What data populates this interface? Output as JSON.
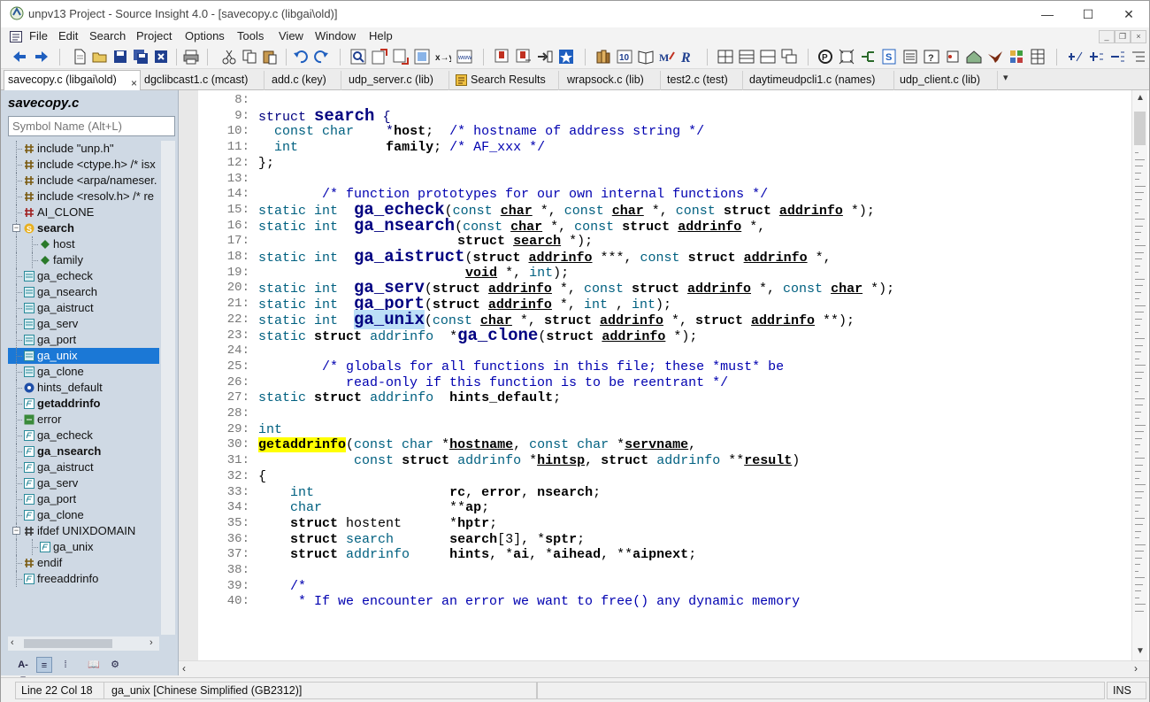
{
  "window": {
    "title": "unpv13 Project - Source Insight 4.0 - [savecopy.c (libgai\\old)]",
    "controls": {
      "minimize": "—",
      "maximize": "☐",
      "close": "✕"
    }
  },
  "menu": {
    "items": [
      "File",
      "Edit",
      "Search",
      "Project",
      "Options",
      "Tools",
      "View",
      "Window",
      "Help"
    ],
    "mdi": {
      "min": "_",
      "restore": "❐",
      "close": "×"
    }
  },
  "tabs": [
    {
      "label": "savecopy.c (libgai\\old)",
      "active": true
    },
    {
      "label": "dgclibcast1.c (mcast)"
    },
    {
      "label": "add.c (key)"
    },
    {
      "label": "udp_server.c (lib)"
    },
    {
      "label": "Search Results"
    },
    {
      "label": "wrapsock.c (lib)"
    },
    {
      "label": "test2.c (test)"
    },
    {
      "label": "daytimeudpcli1.c (names)"
    },
    {
      "label": "udp_client.c (lib)"
    }
  ],
  "tab_close": "×",
  "tab_more": "▾",
  "sidebar": {
    "file_name": "savecopy.c",
    "symbol_placeholder": "Symbol Name (Alt+L)",
    "tree": [
      {
        "label": "include \"unp.h\"",
        "icon": "include-icon"
      },
      {
        "label": "include <ctype.h> /* isx",
        "icon": "include-icon"
      },
      {
        "label": "include <arpa/nameser.",
        "icon": "include-icon"
      },
      {
        "label": "include <resolv.h> /* re",
        "icon": "include-icon"
      },
      {
        "label": "AI_CLONE",
        "icon": "define-icon"
      },
      {
        "label": "search",
        "icon": "struct-icon",
        "bold": true
      },
      {
        "label": "host",
        "icon": "member-icon"
      },
      {
        "label": "family",
        "icon": "member-icon"
      },
      {
        "label": "ga_echeck",
        "icon": "prototype-icon"
      },
      {
        "label": "ga_nsearch",
        "icon": "prototype-icon"
      },
      {
        "label": "ga_aistruct",
        "icon": "prototype-icon"
      },
      {
        "label": "ga_serv",
        "icon": "prototype-icon"
      },
      {
        "label": "ga_port",
        "icon": "prototype-icon"
      },
      {
        "label": "ga_unix",
        "icon": "prototype-icon",
        "selected": true
      },
      {
        "label": "ga_clone",
        "icon": "prototype-icon"
      },
      {
        "label": "hints_default",
        "icon": "variable-icon"
      },
      {
        "label": "getaddrinfo",
        "icon": "function-icon",
        "bold": true
      },
      {
        "label": "error",
        "icon": "label-icon"
      },
      {
        "label": "ga_echeck",
        "icon": "function-icon"
      },
      {
        "label": "ga_nsearch",
        "icon": "function-icon",
        "bold": true
      },
      {
        "label": "ga_aistruct",
        "icon": "function-icon"
      },
      {
        "label": "ga_serv",
        "icon": "function-icon"
      },
      {
        "label": "ga_port",
        "icon": "function-icon"
      },
      {
        "label": "ga_clone",
        "icon": "function-icon"
      },
      {
        "label": "ifdef UNIXDOMAIN",
        "icon": "ifdef-icon"
      },
      {
        "label": "ga_unix",
        "icon": "function-icon"
      },
      {
        "label": "endif",
        "icon": "include-icon"
      },
      {
        "label": "freeaddrinfo",
        "icon": "function-icon"
      }
    ],
    "bottom_buttons": [
      "A-Z",
      "≡",
      "⁞",
      "📖",
      "⚙"
    ]
  },
  "code": {
    "lines": [
      {
        "n": "8:",
        "html": ""
      },
      {
        "n": "9:",
        "html": "<span class='kw'>struct</span> <span class='big'>search</span> <span class='kw'>{</span>"
      },
      {
        "n": "10:",
        "html": "  <span class='ty'>const char</span>    <span class='kw'>*</span><b>host</b>;  <span class='cm'>/* hostname of address string */</span>"
      },
      {
        "n": "11:",
        "html": "  <span class='ty'>int</span>           <b>family</b>; <span class='cm'>/* AF_xxx */</span>"
      },
      {
        "n": "12:",
        "html": "};"
      },
      {
        "n": "13:",
        "html": ""
      },
      {
        "n": "14:",
        "html": "        <span class='cm'>/* function prototypes for our own internal functions */</span>"
      },
      {
        "n": "15:",
        "html": "<span class='ty'>static int</span>  <span class='big'>ga_echeck</span>(<span class='ty'>const</span> <span class='ul'>char</span> *, <span class='ty'>const</span> <span class='ul'>char</span> *, <span class='ty'>const</span> <b>struct</b> <span class='ul'>addrinfo</span> *);"
      },
      {
        "n": "16:",
        "html": "<span class='ty'>static int</span>  <span class='big'>ga_nsearch</span>(<span class='ty'>const</span> <span class='ul'>char</span> *, <span class='ty'>const</span> <b>struct</b> <span class='ul'>addrinfo</span> *,"
      },
      {
        "n": "17:",
        "html": "                         <b>struct</b> <span class='ul'>search</span> *);"
      },
      {
        "n": "18:",
        "html": "<span class='ty'>static int</span>  <span class='big'>ga_aistruct</span>(<b>struct</b> <span class='ul'>addrinfo</span> ***, <span class='ty'>const</span> <b>struct</b> <span class='ul'>addrinfo</span> *,"
      },
      {
        "n": "19:",
        "html": "                          <span class='ul'>void</span> *, <span class='ty'>int</span>);"
      },
      {
        "n": "20:",
        "html": "<span class='ty'>static int</span>  <span class='big'>ga_serv</span>(<b>struct</b> <span class='ul'>addrinfo</span> *, <span class='ty'>const</span> <b>struct</b> <span class='ul'>addrinfo</span> *, <span class='ty'>const</span> <span class='ul'>char</span> *);"
      },
      {
        "n": "21:",
        "html": "<span class='ty'>static int</span>  <span class='big'>ga_port</span>(<b>struct</b> <span class='ul'>addrinfo</span> *, <span class='ty'>int</span> , <span class='ty'>int</span>);"
      },
      {
        "n": "22:",
        "html": "<span class='ty'>static int</span>  <span class='big hlb'>ga_unix</span>(<span class='ty'>const</span> <span class='ul'>char</span> *, <b>struct</b> <span class='ul'>addrinfo</span> *, <b>struct</b> <span class='ul'>addrinfo</span> **);"
      },
      {
        "n": "23:",
        "html": "<span class='ty'>static</span> <b>struct</b> <span class='ty'>addrinfo</span>  *<span class='big'>ga_clone</span>(<b>struct</b> <span class='ul'>addrinfo</span> *);"
      },
      {
        "n": "24:",
        "html": ""
      },
      {
        "n": "25:",
        "html": "        <span class='cm'>/* globals for all functions in this file; these *must* be</span>"
      },
      {
        "n": "26:",
        "html": "<span class='cm'>           read-only if this function is to be reentrant */</span>"
      },
      {
        "n": "27:",
        "html": "<span class='ty'>static</span> <b>struct</b> <span class='ty'>addrinfo</span>  <b>hints_default</b>;"
      },
      {
        "n": "28:",
        "html": ""
      },
      {
        "n": "29:",
        "html": "<span class='ty'>int</span>"
      },
      {
        "n": "30:",
        "html": "<span class='hly'><b>getaddrinfo</b></span>(<span class='ty'>const char</span> *<span class='ul'>hostname</span>, <span class='ty'>const char</span> *<span class='ul'>servname</span>,"
      },
      {
        "n": "31:",
        "html": "            <span class='ty'>const</span> <b>struct</b> <span class='ty'>addrinfo</span> *<span class='ul'>hintsp</span>, <b>struct</b> <span class='ty'>addrinfo</span> **<span class='ul'>result</span>)"
      },
      {
        "n": "32:",
        "html": "{"
      },
      {
        "n": "33:",
        "html": "    <span class='ty'>int</span>                 <b>rc</b>, <b>error</b>, <b>nsearch</b>;"
      },
      {
        "n": "34:",
        "html": "    <span class='ty'>char</span>                **<b>ap</b>;"
      },
      {
        "n": "35:",
        "html": "    <b>struct</b> hostent      *<b>hptr</b>;"
      },
      {
        "n": "36:",
        "html": "    <b>struct</b> <span class='ty'>search</span>       <b>search</b>[3], *<b>sptr</b>;"
      },
      {
        "n": "37:",
        "html": "    <b>struct</b> <span class='ty'>addrinfo</span>     <b>hints</b>, *<b>ai</b>, *<b>aihead</b>, **<b>aipnext</b>;"
      },
      {
        "n": "38:",
        "html": ""
      },
      {
        "n": "39:",
        "html": "    <span class='cm'>/*</span>"
      },
      {
        "n": "40:",
        "html": "<span class='cm'>     * If we encounter an error we want to free() any dynamic memory</span>"
      }
    ]
  },
  "status": {
    "position": "Line 22  Col 18",
    "symbol": "ga_unix [Chinese Simplified (GB2312)]",
    "mode": "INS"
  }
}
